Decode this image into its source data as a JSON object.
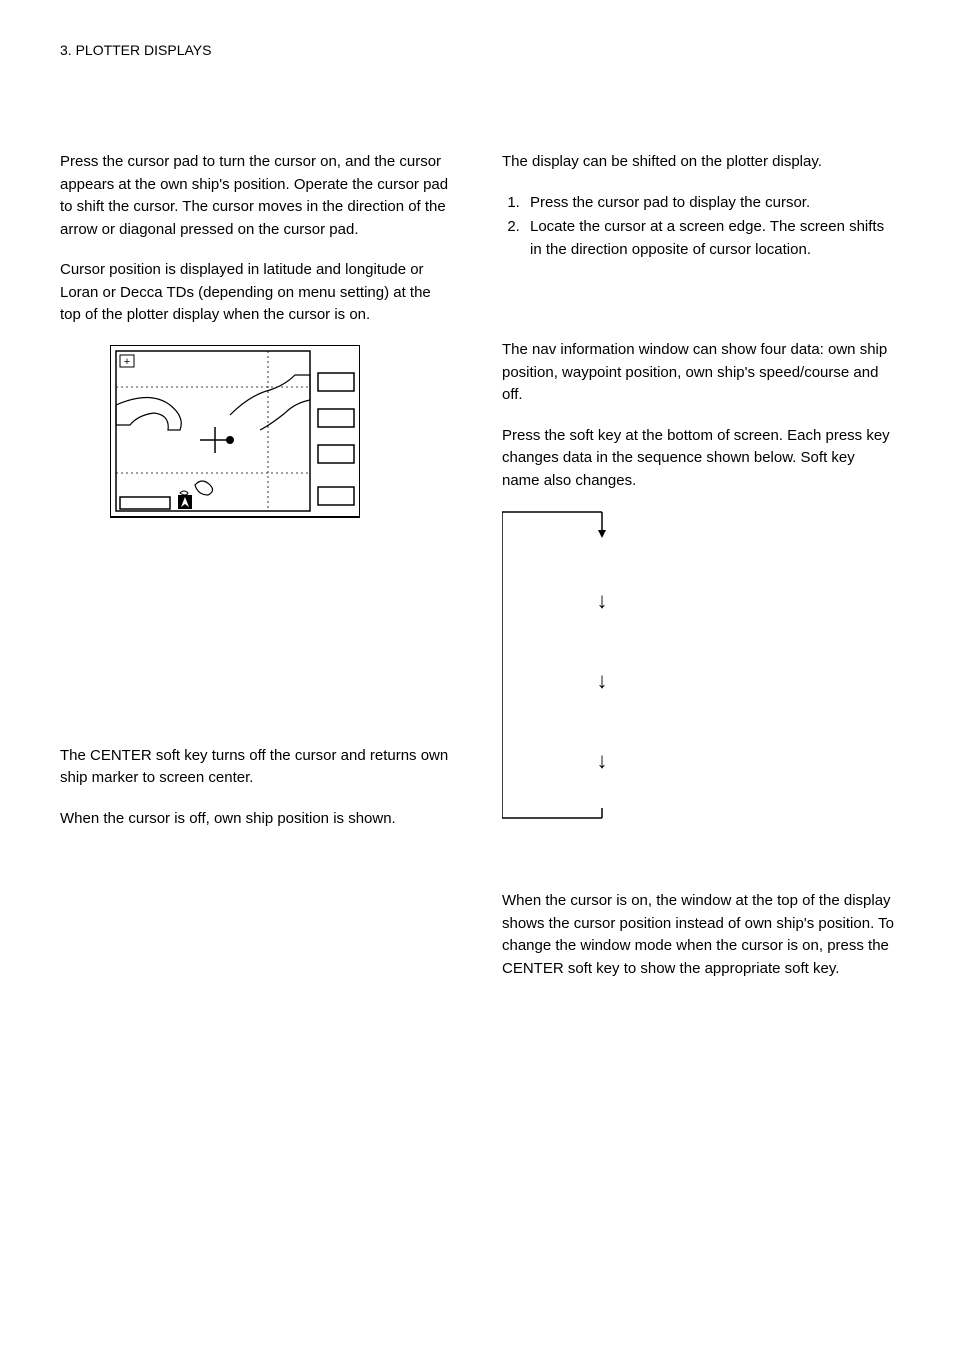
{
  "header": "3. PLOTTER DISPLAYS",
  "left": {
    "p1": "Press the cursor pad to turn the cursor on, and the cursor appears at the own ship's position. Operate the cursor pad to shift the cursor. The cursor moves in the direction of the arrow or diagonal pressed on the cursor pad.",
    "p2": "Cursor position is displayed in latitude and longitude or Loran or Decca TDs (depending on menu setting) at the top of the plotter display when the cursor is on.",
    "plus": "+",
    "p3": "The CENTER soft key turns off the cursor and returns own ship marker to screen center.",
    "p4": "When the cursor is off, own ship position is shown."
  },
  "right": {
    "p1": "The display can be shifted on the plotter display.",
    "li1": "Press the cursor pad to display the cursor.",
    "li2": "Locate the cursor at a screen edge. The screen shifts in the direction opposite of cursor location.",
    "p2": "The nav information window can show four data: own ship position, waypoint position, own ship's speed/course and off.",
    "p3": "Press the soft key at the bottom of screen. Each press key changes data in the sequence shown below. Soft key name also changes.",
    "arrow": "↓",
    "p4": "When the cursor is on, the window at the top of the display shows the cursor position instead of own ship's position. To change the window mode when the cursor is on, press the CENTER soft key to show the appropriate soft key."
  }
}
